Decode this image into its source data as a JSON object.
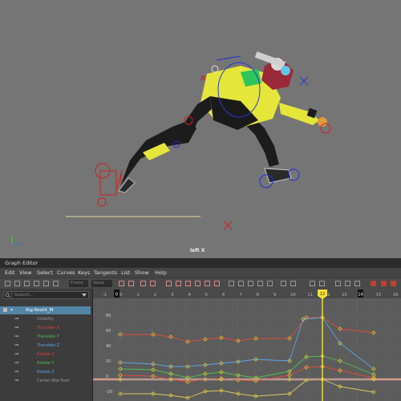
{
  "viewport": {
    "camera_label": "left X"
  },
  "graph_editor": {
    "title": "Graph Editor",
    "menu": [
      "Edit",
      "View",
      "Select",
      "Curves",
      "Keys",
      "Tangents",
      "List",
      "Show",
      "Help"
    ],
    "toolbar": {
      "frame_placeholder": "Frame",
      "value_placeholder": "Value"
    },
    "search_placeholder": "Search...",
    "outliner": [
      {
        "label": "Rig:RootX_M",
        "selected": true,
        "color": "#ffffff"
      },
      {
        "label": "Visibility",
        "color": "#9a9a9a"
      },
      {
        "label": "Translate X",
        "color": "#e04040"
      },
      {
        "label": "Translate Y",
        "color": "#4fbf4f"
      },
      {
        "label": "Translate Z",
        "color": "#5aa6e6"
      },
      {
        "label": "Rotate X",
        "color": "#e04040"
      },
      {
        "label": "Rotate Y",
        "color": "#4fbf4f"
      },
      {
        "label": "Rotate Z",
        "color": "#5aa6e6"
      },
      {
        "label": "Center Btw Feet",
        "color": "#9a9a9a"
      }
    ],
    "timeline": {
      "ticks": [
        "-1",
        "0",
        "1",
        "2",
        "3",
        "4",
        "5",
        "6",
        "7",
        "8",
        "9",
        "10",
        "11",
        "12",
        "13",
        "14",
        "15",
        "16"
      ],
      "current_frame": "12",
      "range_start": "0",
      "range_end": "14"
    },
    "y_ticks": [
      "80",
      "60",
      "40",
      "20",
      "0",
      "-20"
    ],
    "curve_colors": {
      "red": "#e04a3a",
      "green": "#4fbf4f",
      "blue": "#5aa6e6",
      "gray": "#9a9a9a"
    }
  }
}
